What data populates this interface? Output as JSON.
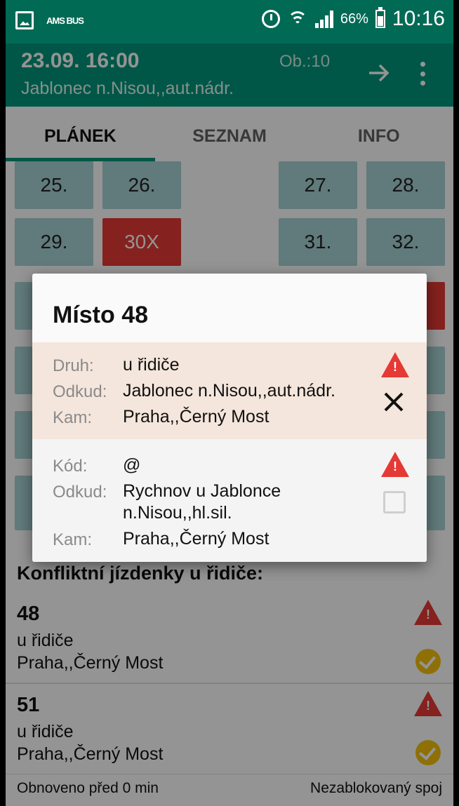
{
  "status_bar": {
    "app_badge": "AMS BUS",
    "battery": "66%",
    "time": "10:16",
    "icons": [
      "image-icon",
      "amsbus-icon",
      "alarm-icon",
      "wifi-icon",
      "signal-icon",
      "battery-icon"
    ]
  },
  "header": {
    "datetime": "23.09. 16:00",
    "obs": "Ob.:10",
    "station": "Jablonec n.Nisou,,aut.nádr.",
    "icons": [
      "arrow-right-icon",
      "more-vert-icon"
    ]
  },
  "tabs": [
    {
      "label": "PLÁNEK",
      "active": true
    },
    {
      "label": "SEZNAM",
      "active": false
    },
    {
      "label": "INFO",
      "active": false
    }
  ],
  "seats": {
    "row1": [
      "25.",
      "26.",
      "27.",
      "28."
    ],
    "row2": [
      "29.",
      "30X",
      "31.",
      "32."
    ]
  },
  "dialog": {
    "title": "Místo 48",
    "entry1": {
      "label_type": "Druh:",
      "type": "u řidiče",
      "label_from": "Odkud:",
      "from": "Jablonec n.Nisou,,aut.nádr.",
      "label_to": "Kam:",
      "to": "Praha,,Černý Most"
    },
    "entry2": {
      "label_code": "Kód:",
      "code": "@",
      "label_from": "Odkud:",
      "from_line1": "Rychnov u Jablonce",
      "from_line2": "n.Nisou,,hl.sil.",
      "label_to": "Kam:",
      "to": "Praha,,Černý Most"
    },
    "warning_mark": "!"
  },
  "conflicts": {
    "title": "Konfliktní jízdenky u řidiče:",
    "items": [
      {
        "seat": "48",
        "type": "u řidiče",
        "dest": "Praha,,Černý Most"
      },
      {
        "seat": "51",
        "type": "u řidiče",
        "dest": "Praha,,Černý Most"
      }
    ]
  },
  "footer": {
    "refreshed": "Obnoveno před 0 min",
    "status": "Nezablokovaný spoj"
  },
  "colors": {
    "statusbar": "#006a55",
    "appbar": "#00977a",
    "seat": "#a7d3d5",
    "seat_blocked": "#e53935",
    "warning": "#e53935",
    "ok": "#f4c20d",
    "dialog_highlight": "#f4e6dc"
  }
}
